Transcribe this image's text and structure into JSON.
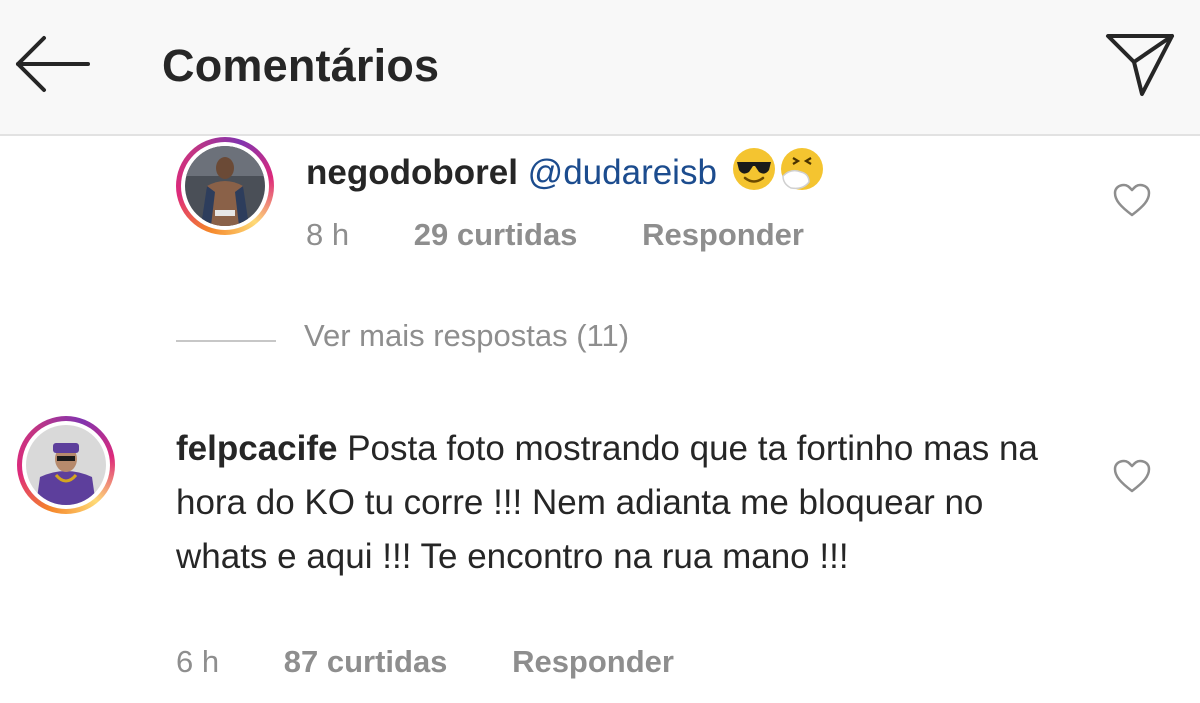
{
  "header": {
    "title": "Comentários",
    "back_icon": "arrow-left-icon",
    "send_icon": "paper-plane-icon"
  },
  "comments": [
    {
      "username": "negodoborel",
      "mention": "@dudareisb",
      "emojis": [
        "smiling-face-with-sunglasses",
        "sneezing-face"
      ],
      "time": "8 h",
      "likes": "29 curtidas",
      "reply": "Responder"
    },
    {
      "username": "felpcacife",
      "text": "Posta foto mostrando que ta fortinho mas na hora do KO tu corre !!! Nem adianta me bloquear no whats e aqui !!! Te encontro na rua mano !!!",
      "time": "6 h",
      "likes": "87 curtidas",
      "reply": "Responder"
    }
  ],
  "more_replies": "Ver mais respostas (11)",
  "colors": {
    "mention": "#1c4c8e",
    "meta": "#8e8e8e",
    "header_bg": "#f8f8f8",
    "text": "#262626"
  }
}
